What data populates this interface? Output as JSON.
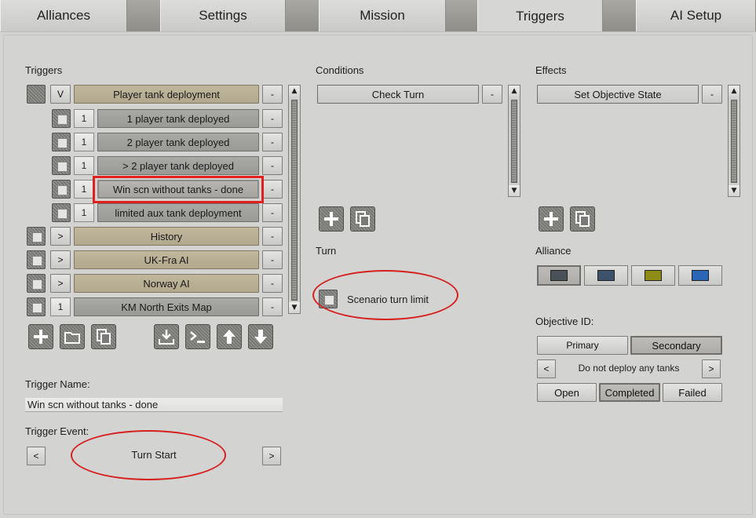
{
  "tabs": [
    {
      "label": "Alliances",
      "active": false
    },
    {
      "label": "Settings",
      "active": false
    },
    {
      "label": "Mission",
      "active": false
    },
    {
      "label": "Triggers",
      "active": true
    },
    {
      "label": "AI Setup",
      "active": false
    }
  ],
  "triggers": {
    "heading": "Triggers",
    "rows": [
      {
        "toggle": "V",
        "name": "Player tank deployment",
        "style": "tan",
        "minus": "-"
      },
      {
        "count": "1",
        "name": "1 player tank deployed",
        "style": "grey",
        "minus": "-"
      },
      {
        "count": "1",
        "name": "2 player tank deployed",
        "style": "grey",
        "minus": "-"
      },
      {
        "count": "1",
        "name": "> 2 player tank deployed",
        "style": "grey",
        "minus": "-"
      },
      {
        "count": "1",
        "name": "Win scn without tanks - done",
        "style": "selected",
        "minus": "-"
      },
      {
        "count": "1",
        "name": "limited aux tank deployment",
        "style": "grey",
        "minus": "-"
      },
      {
        "toggle": ">",
        "name": "History",
        "style": "tan",
        "minus": "-"
      },
      {
        "toggle": ">",
        "name": "UK-Fra AI",
        "style": "tan",
        "minus": "-"
      },
      {
        "toggle": ">",
        "name": "Norway AI",
        "style": "tan",
        "minus": "-"
      },
      {
        "count": "1",
        "name": "KM North Exits Map",
        "style": "grey",
        "minus": "-"
      }
    ],
    "name_label": "Trigger Name:",
    "name_value": "Win scn without tanks - done",
    "event_label": "Trigger Event:",
    "event_value": "Turn Start",
    "prev": "<",
    "next": ">"
  },
  "conditions": {
    "heading": "Conditions",
    "items": [
      {
        "name": "Check Turn",
        "minus": "-"
      }
    ],
    "turn_label": "Turn",
    "checkbox_label": "Scenario turn limit"
  },
  "effects": {
    "heading": "Effects",
    "items": [
      {
        "name": "Set Objective State",
        "minus": "-"
      }
    ],
    "alliance_label": "Alliance",
    "alliance_colors": [
      "#4a5058",
      "#3d536c",
      "#8c8c16",
      "#2a65b8"
    ],
    "objective_label": "Objective ID:",
    "primary": "Primary",
    "secondary": "Secondary",
    "objective_prev": "<",
    "objective_value": "Do not deploy any tanks",
    "objective_next": ">",
    "state_open": "Open",
    "state_completed": "Completed",
    "state_failed": "Failed"
  },
  "scroll": {
    "up": "▲",
    "down": "▼"
  }
}
